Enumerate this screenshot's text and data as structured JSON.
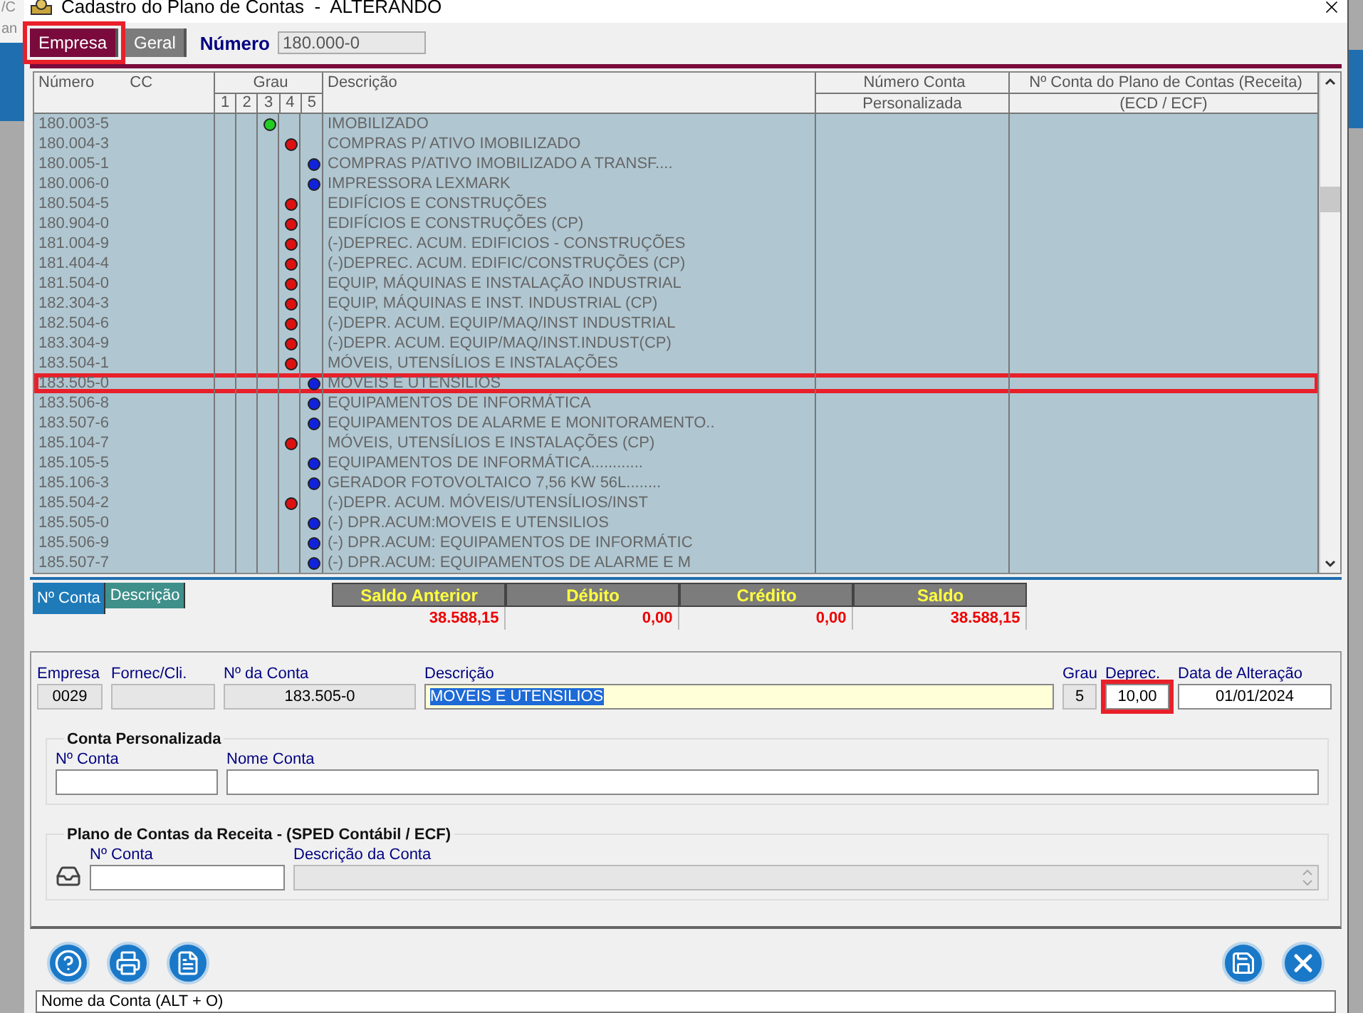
{
  "background_app": {
    "fragments": [
      "/C",
      "an"
    ]
  },
  "window": {
    "title": "Cadastro do Plano de Contas  -  ALTERANDO"
  },
  "tabs": [
    {
      "label": "Empresa",
      "selected": true,
      "highlighted": true
    },
    {
      "label": "Geral",
      "selected": false,
      "highlighted": false
    }
  ],
  "numero": {
    "label": "Número",
    "value": "180.000-0"
  },
  "table": {
    "header": {
      "numero": "Número",
      "cc": "CC",
      "grau": "Grau",
      "grau_levels": [
        "1",
        "2",
        "3",
        "4",
        "5"
      ],
      "descricao": "Descrição",
      "conta_personalizada": [
        "Número Conta",
        "Personalizada"
      ],
      "conta_receita": [
        "Nº Conta do Plano de Contas (Receita)",
        "(ECD / ECF)"
      ]
    },
    "rows": [
      {
        "numero": "180.003-5",
        "kind": "level3",
        "color": "#22cc22",
        "descricao": "IMOBILIZADO",
        "highlighted": false
      },
      {
        "numero": "180.004-3",
        "kind": "level4",
        "color": "#dd1111",
        "descricao": "COMPRAS P/ ATIVO IMOBILIZADO",
        "highlighted": false
      },
      {
        "numero": "180.005-1",
        "kind": "level5",
        "color": "#1122dd",
        "descricao": "COMPRAS P/ATIVO IMOBILIZADO A TRANSF....",
        "highlighted": false
      },
      {
        "numero": "180.006-0",
        "kind": "level5",
        "color": "#1122dd",
        "descricao": "IMPRESSORA LEXMARK",
        "highlighted": false
      },
      {
        "numero": "180.504-5",
        "kind": "level4",
        "color": "#dd1111",
        "descricao": "EDIFÍCIOS E CONSTRUÇÕES",
        "highlighted": false
      },
      {
        "numero": "180.904-0",
        "kind": "level4",
        "color": "#dd1111",
        "descricao": "EDIFÍCIOS E CONSTRUÇÕES (CP)",
        "highlighted": false
      },
      {
        "numero": "181.004-9",
        "kind": "level4",
        "color": "#dd1111",
        "descricao": "(-)DEPREC. ACUM. EDIFICIOS - CONSTRUÇÕES",
        "highlighted": false
      },
      {
        "numero": "181.404-4",
        "kind": "level4",
        "color": "#dd1111",
        "descricao": "(-)DEPREC. ACUM. EDIFIC/CONSTRUÇÕES (CP)",
        "highlighted": false
      },
      {
        "numero": "181.504-0",
        "kind": "level4",
        "color": "#dd1111",
        "descricao": "EQUIP, MÁQUINAS E INSTALAÇÃO INDUSTRIAL",
        "highlighted": false
      },
      {
        "numero": "182.304-3",
        "kind": "level4",
        "color": "#dd1111",
        "descricao": "EQUIP, MÁQUINAS E INST. INDUSTRIAL (CP)",
        "highlighted": false
      },
      {
        "numero": "182.504-6",
        "kind": "level4",
        "color": "#dd1111",
        "descricao": "(-)DEPR. ACUM. EQUIP/MAQ/INST INDUSTRIAL",
        "highlighted": false
      },
      {
        "numero": "183.304-9",
        "kind": "level4",
        "color": "#dd1111",
        "descricao": "(-)DEPR. ACUM. EQUIP/MAQ/INST.INDUST(CP)",
        "highlighted": false
      },
      {
        "numero": "183.504-1",
        "kind": "level4",
        "color": "#dd1111",
        "descricao": "MÓVEIS, UTENSÍLIOS E INSTALAÇÕES",
        "highlighted": false
      },
      {
        "numero": "183.505-0",
        "kind": "level5",
        "color": "#1122dd",
        "descricao": "MOVEIS E UTENSILIOS",
        "highlighted": true
      },
      {
        "numero": "183.506-8",
        "kind": "level5",
        "color": "#1122dd",
        "descricao": "EQUIPAMENTOS DE INFORMÁTICA",
        "highlighted": false
      },
      {
        "numero": "183.507-6",
        "kind": "level5",
        "color": "#1122dd",
        "descricao": "EQUIPAMENTOS DE ALARME E MONITORAMENTO..",
        "highlighted": false
      },
      {
        "numero": "185.104-7",
        "kind": "level4",
        "color": "#dd1111",
        "descricao": "MÓVEIS, UTENSÍLIOS E INSTALAÇÕES (CP)",
        "highlighted": false
      },
      {
        "numero": "185.105-5",
        "kind": "level5",
        "color": "#1122dd",
        "descricao": "EQUIPAMENTOS DE INFORMÁTICA............",
        "highlighted": false
      },
      {
        "numero": "185.106-3",
        "kind": "level5",
        "color": "#1122dd",
        "descricao": "GERADOR FOTOVOLTAICO 7,56 KW 56L........",
        "highlighted": false
      },
      {
        "numero": "185.504-2",
        "kind": "level4",
        "color": "#dd1111",
        "descricao": "(-)DEPR. ACUM. MÓVEIS/UTENSÍLIOS/INST",
        "highlighted": false
      },
      {
        "numero": "185.505-0",
        "kind": "level5",
        "color": "#1122dd",
        "descricao": "(-) DPR.ACUM:MOVEIS E UTENSILIOS",
        "highlighted": false
      },
      {
        "numero": "185.506-9",
        "kind": "level5",
        "color": "#1122dd",
        "descricao": "(-) DPR.ACUM: EQUIPAMENTOS DE INFORMÁTIC",
        "highlighted": false
      },
      {
        "numero": "185.507-7",
        "kind": "level5",
        "color": "#1122dd",
        "descricao": "(-) DPR.ACUM: EQUIPAMENTOS DE ALARME E M",
        "highlighted": false
      }
    ]
  },
  "view_tabs": [
    {
      "label": "Nº Conta",
      "selected": true
    },
    {
      "label": "Descrição",
      "selected": false
    }
  ],
  "totals": [
    {
      "label": "Saldo Anterior",
      "value": "38.588,15"
    },
    {
      "label": "Débito",
      "value": "0,00"
    },
    {
      "label": "Crédito",
      "value": "0,00"
    },
    {
      "label": "Saldo",
      "value": "38.588,15"
    }
  ],
  "form": {
    "fields": [
      {
        "label": "Empresa",
        "value": "0029",
        "kind": "readonly",
        "highlighted": false
      },
      {
        "label": "Fornec/Cli.",
        "kind": "readonly",
        "highlighted": false
      },
      {
        "label": "Nº da Conta",
        "value": "183.505-0",
        "kind": "readonly",
        "highlighted": false
      },
      {
        "label": "Descrição",
        "value": "MOVEIS E UTENSILIOS",
        "kind": "selected-text",
        "highlighted": false
      },
      {
        "label": "Grau",
        "value": "5",
        "kind": "readonly",
        "highlighted": false
      },
      {
        "label": "Deprec.",
        "value": "10,00",
        "kind": "editable",
        "highlighted": true
      },
      {
        "label": "Data de Alteração",
        "value": "01/01/2024",
        "kind": "editable",
        "highlighted": false
      }
    ]
  },
  "conta_personalizada": {
    "title": "Conta Personalizada",
    "fields": [
      {
        "label": "Nº Conta"
      },
      {
        "label": "Nome Conta"
      }
    ]
  },
  "plano_receita": {
    "title": "Plano de Contas da Receita - (SPED Contábil / ECF)",
    "fields": [
      {
        "label": "Nº Conta",
        "disabled": false
      },
      {
        "label": "Descrição da Conta",
        "disabled": true
      }
    ]
  },
  "status_bar": {
    "text": "Nome da Conta (ALT + O)"
  }
}
